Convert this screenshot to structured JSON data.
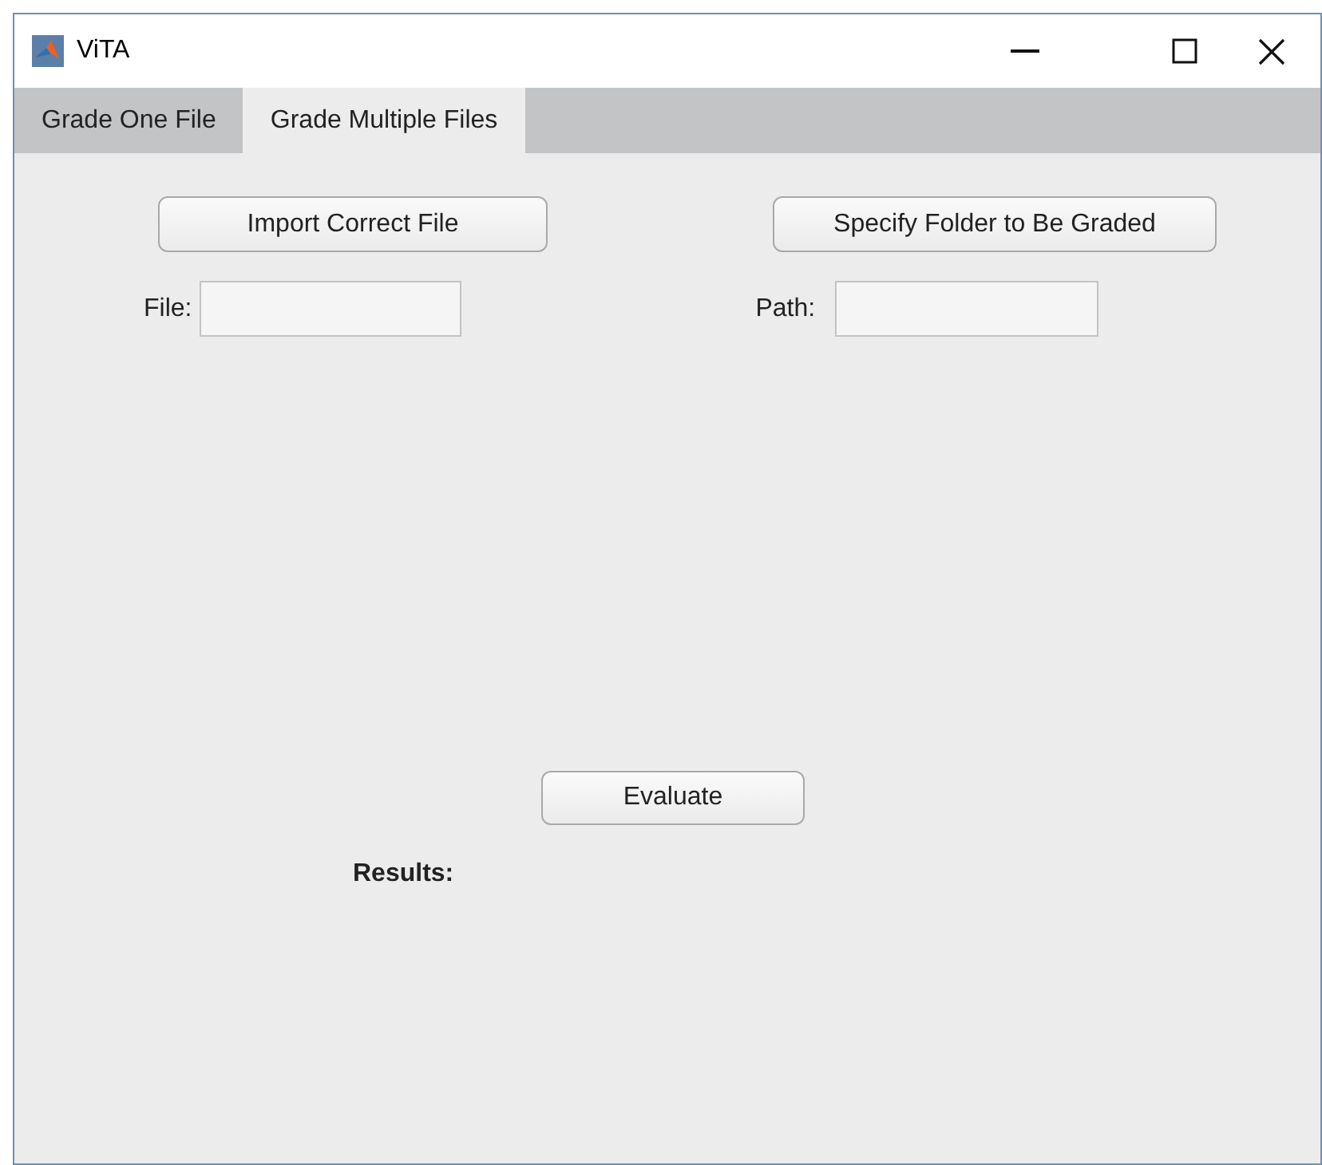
{
  "window": {
    "title": "ViTA"
  },
  "tabs": [
    {
      "label": "Grade One File",
      "selected": false
    },
    {
      "label": "Grade Multiple Files",
      "selected": true
    }
  ],
  "import_button": "Import Correct File",
  "folder_button": "Specify Folder to Be Graded",
  "file_field": {
    "label": "File:"
  },
  "path_field": {
    "label": "Path:"
  },
  "evaluate_button": "Evaluate",
  "results_label": "Results:"
}
